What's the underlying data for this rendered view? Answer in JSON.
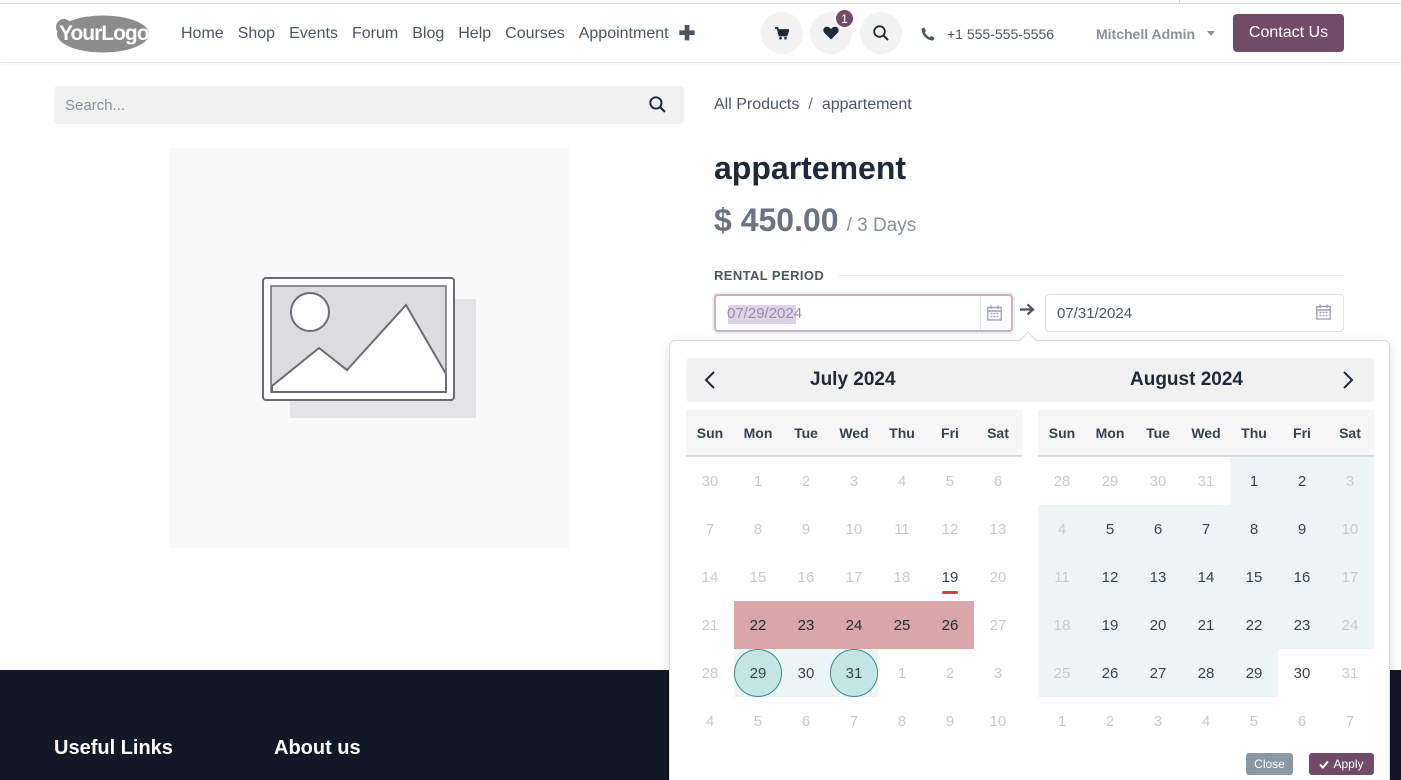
{
  "logo": {
    "text": "YourLogo"
  },
  "nav": {
    "items": [
      "Home",
      "Shop",
      "Events",
      "Forum",
      "Blog",
      "Help",
      "Courses",
      "Appointment"
    ],
    "plus": "✚"
  },
  "header": {
    "wishlist_count": "1",
    "phone": "+1 555-555-5556",
    "user": "Mitchell Admin",
    "contact_label": "Contact Us"
  },
  "search": {
    "placeholder": "Search..."
  },
  "breadcrumb": {
    "parent": "All Products",
    "separator": "/",
    "current": "appartement"
  },
  "product": {
    "title": "appartement",
    "price": "$ 450.00",
    "per": "/ 3 Days",
    "rental_label": "RENTAL PERIOD",
    "start_date": "07/29/2024",
    "end_date": "07/31/2024"
  },
  "calendar": {
    "weekdays": [
      "Sun",
      "Mon",
      "Tue",
      "Wed",
      "Thu",
      "Fri",
      "Sat"
    ],
    "months": [
      {
        "title": "July 2024",
        "weeks": [
          [
            "30",
            "1",
            "2",
            "3",
            "4",
            "5",
            "6"
          ],
          [
            "7",
            "8",
            "9",
            "10",
            "11",
            "12",
            "13"
          ],
          [
            "14",
            "15",
            "16",
            "17",
            "18",
            "19",
            "20"
          ],
          [
            "21",
            "22",
            "23",
            "24",
            "25",
            "26",
            "27"
          ],
          [
            "28",
            "29",
            "30",
            "31",
            "1",
            "2",
            "3"
          ],
          [
            "4",
            "5",
            "6",
            "7",
            "8",
            "9",
            "10"
          ]
        ],
        "states": [
          [
            "m",
            "m",
            "m",
            "m",
            "m",
            "m",
            "m"
          ],
          [
            "m",
            "m",
            "m",
            "m",
            "m",
            "m",
            "m"
          ],
          [
            "m",
            "m",
            "m",
            "m",
            "m",
            "t",
            "m"
          ],
          [
            "m",
            "p",
            "p",
            "p",
            "p",
            "p",
            "m"
          ],
          [
            "m",
            "e",
            "r",
            "e",
            "m",
            "m",
            "m"
          ],
          [
            "m",
            "m",
            "m",
            "m",
            "m",
            "m",
            "m"
          ]
        ]
      },
      {
        "title": "August 2024",
        "weeks": [
          [
            "28",
            "29",
            "30",
            "31",
            "1",
            "2",
            "3"
          ],
          [
            "4",
            "5",
            "6",
            "7",
            "8",
            "9",
            "10"
          ],
          [
            "11",
            "12",
            "13",
            "14",
            "15",
            "16",
            "17"
          ],
          [
            "18",
            "19",
            "20",
            "21",
            "22",
            "23",
            "24"
          ],
          [
            "25",
            "26",
            "27",
            "28",
            "29",
            "30",
            "31"
          ],
          [
            "1",
            "2",
            "3",
            "4",
            "5",
            "6",
            "7"
          ]
        ],
        "states": [
          [
            "m",
            "m",
            "m",
            "m",
            "r",
            "r",
            "mr"
          ],
          [
            "mr",
            "r",
            "r",
            "r",
            "r",
            "r",
            "mr"
          ],
          [
            "mr",
            "r",
            "r",
            "r",
            "r",
            "r",
            "mr"
          ],
          [
            "mr",
            "r",
            "r",
            "r",
            "r",
            "r",
            "mr"
          ],
          [
            "mr",
            "r",
            "r",
            "r",
            "r",
            "n",
            "m"
          ],
          [
            "m",
            "m",
            "m",
            "m",
            "m",
            "m",
            "m"
          ]
        ]
      }
    ],
    "close_label": "Close",
    "apply_label": "Apply"
  },
  "footer": {
    "col1": "Useful Links",
    "col2": "About us"
  },
  "colors": {
    "brand": "#714b67",
    "range": "#ebf5f5",
    "selected_week": "#d9a6a9",
    "endpoint": "#c3e6e4",
    "today_mark": "#d23f46"
  }
}
